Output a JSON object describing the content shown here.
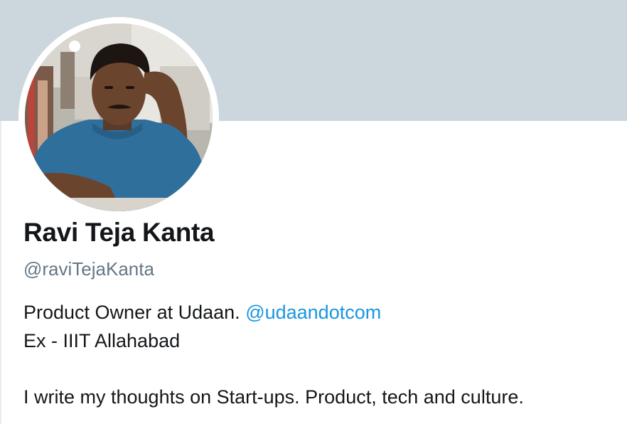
{
  "profile": {
    "name": "Ravi Teja Kanta",
    "handle": "@raviTejaKanta",
    "bio": {
      "line1_text": "Product Owner at Udaan.",
      "line1_mention": "@udaandotcom",
      "line2": "Ex - IIIT Allahabad",
      "line3": "I write my thoughts on Start-ups. Product, tech and culture."
    }
  },
  "colors": {
    "banner": "#ccd6dd",
    "name": "#14171a",
    "handle": "#657786",
    "link": "#1b95e0"
  }
}
